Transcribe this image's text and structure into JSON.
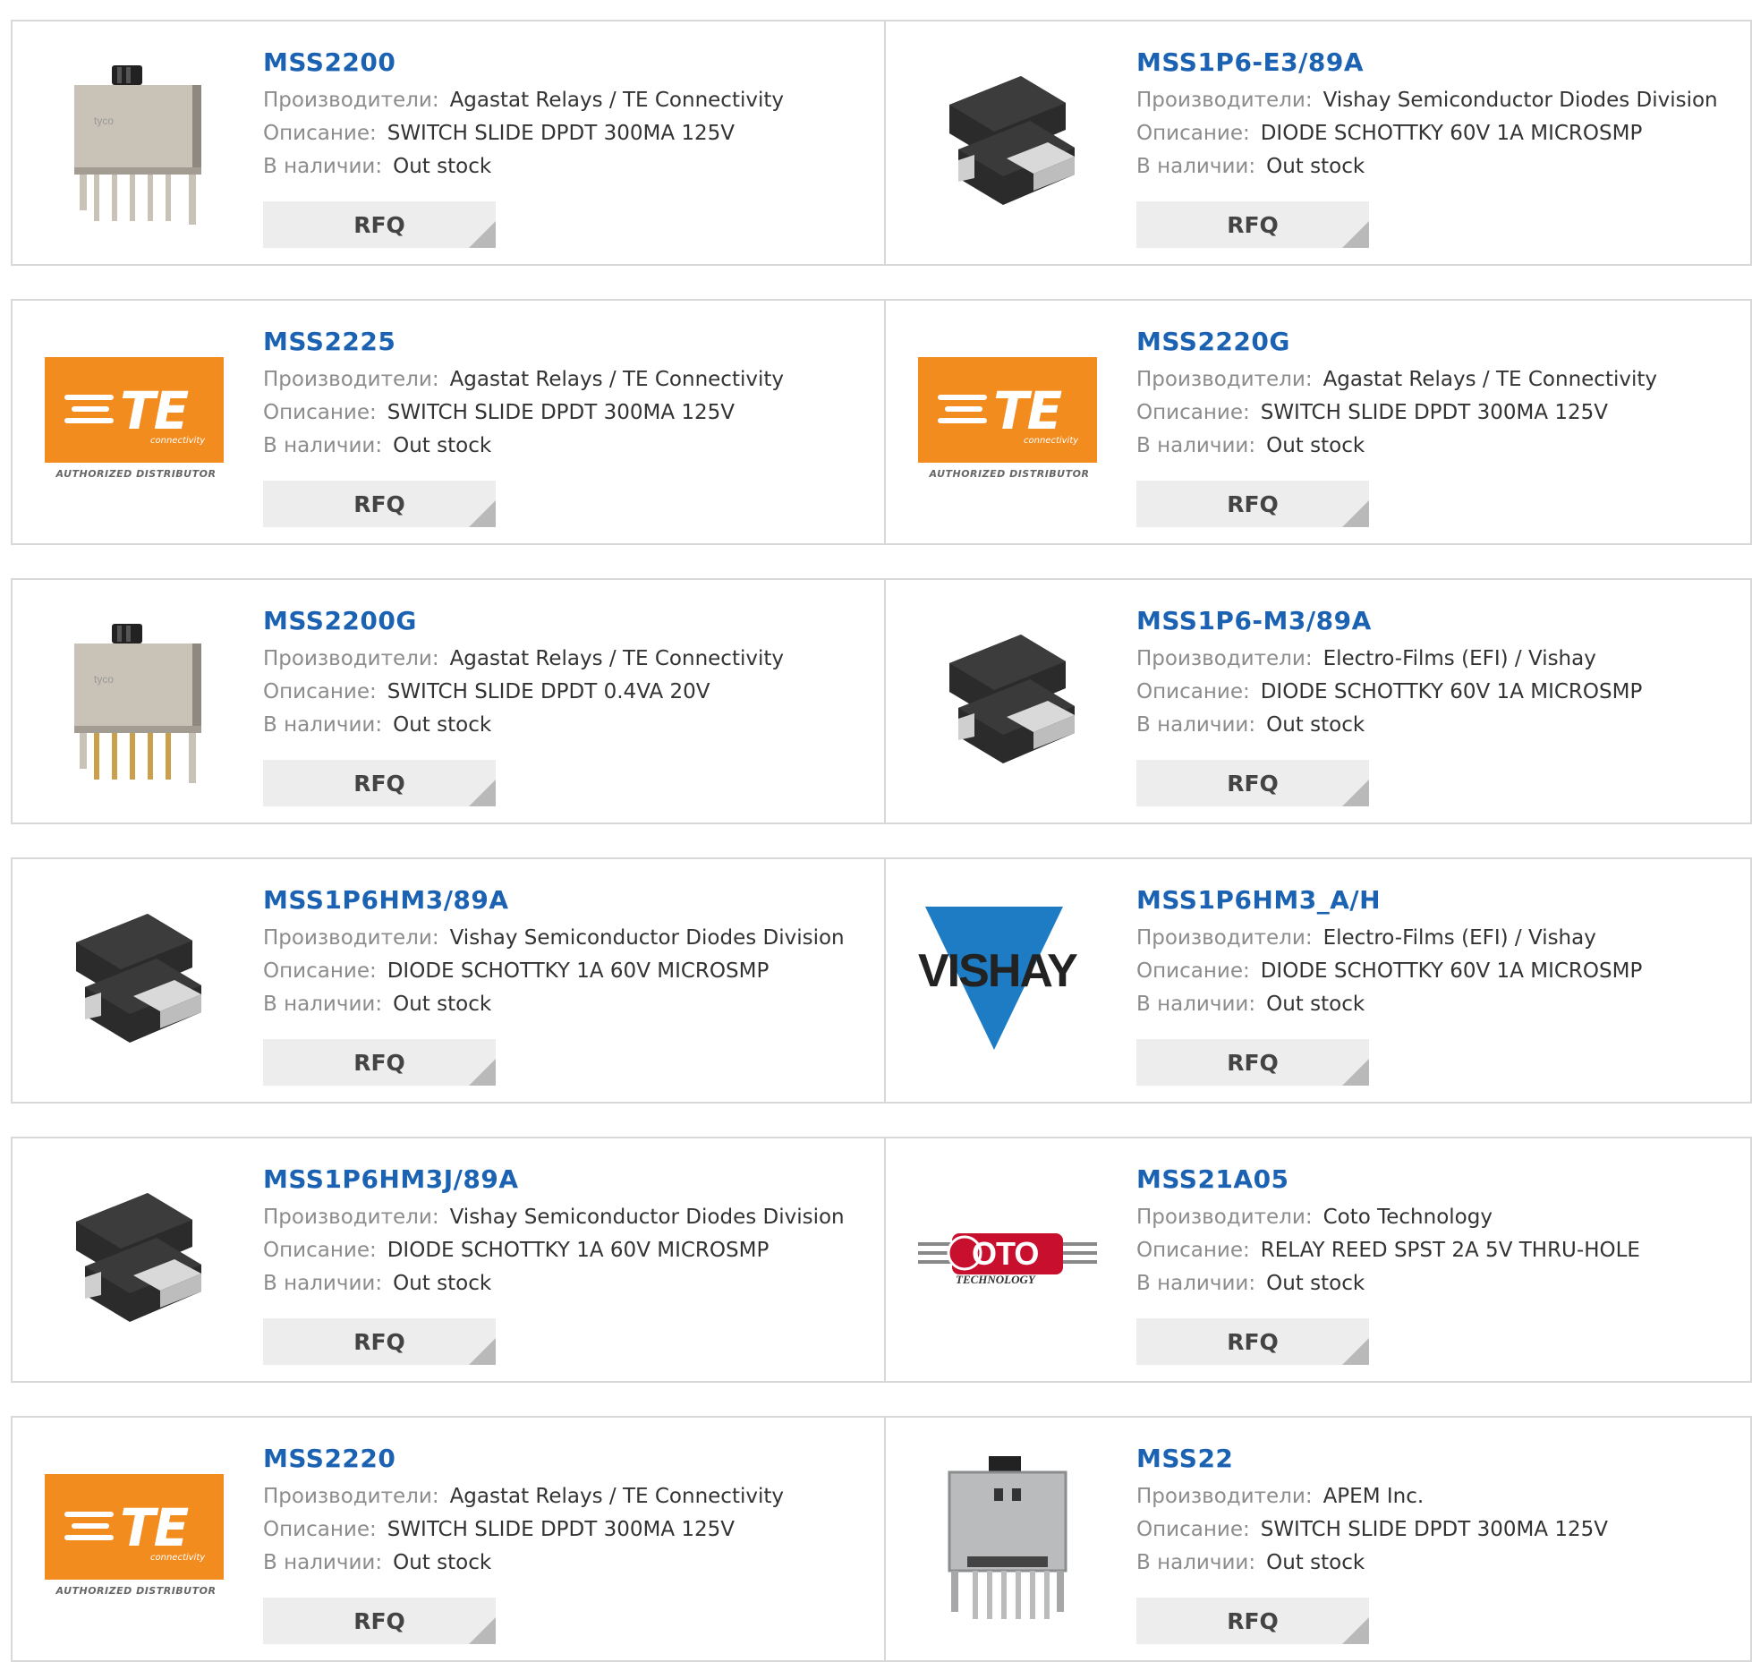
{
  "labels": {
    "manufacturer": "Производители:",
    "description": "Описание:",
    "stock": "В наличии:",
    "rfq": "RFQ"
  },
  "logos": {
    "te": {
      "word": "TE",
      "sub": "connectivity",
      "auth": "AUTHORIZED DISTRIBUTOR",
      "color": "#f28c1e"
    },
    "vishay": {
      "word": "VISHAY",
      "color": "#1d7cc4"
    },
    "coto": {
      "word": "OTO",
      "sub": "TECHNOLOGY",
      "color": "#c8102e"
    }
  },
  "colors": {
    "link": "#1b62b3",
    "label": "#8c8c8c",
    "button": "#ededed",
    "border": "#d8d8d8"
  },
  "products": [
    {
      "part": "MSS2200",
      "manufacturer": "Agastat Relays / TE Connectivity",
      "description": "SWITCH SLIDE DPDT 300MA 125V",
      "stock": "Out stock",
      "image": "slide-switch"
    },
    {
      "part": "MSS1P6-E3/89A",
      "manufacturer": "Vishay Semiconductor Diodes Division",
      "description": "DIODE SCHOTTKY 60V 1A MICROSMP",
      "stock": "Out stock",
      "image": "smd-diode"
    },
    {
      "part": "MSS2225",
      "manufacturer": "Agastat Relays / TE Connectivity",
      "description": "SWITCH SLIDE DPDT 300MA 125V",
      "stock": "Out stock",
      "image": "te-logo"
    },
    {
      "part": "MSS2220G",
      "manufacturer": "Agastat Relays / TE Connectivity",
      "description": "SWITCH SLIDE DPDT 300MA 125V",
      "stock": "Out stock",
      "image": "te-logo"
    },
    {
      "part": "MSS2200G",
      "manufacturer": "Agastat Relays / TE Connectivity",
      "description": "SWITCH SLIDE DPDT 0.4VA 20V",
      "stock": "Out stock",
      "image": "slide-switch-gold"
    },
    {
      "part": "MSS1P6-M3/89A",
      "manufacturer": "Electro-Films (EFI) / Vishay",
      "description": "DIODE SCHOTTKY 60V 1A MICROSMP",
      "stock": "Out stock",
      "image": "smd-diode"
    },
    {
      "part": "MSS1P6HM3/89A",
      "manufacturer": "Vishay Semiconductor Diodes Division",
      "description": "DIODE SCHOTTKY 1A 60V MICROSMP",
      "stock": "Out stock",
      "image": "smd-diode"
    },
    {
      "part": "MSS1P6HM3_A/H",
      "manufacturer": "Electro-Films (EFI) / Vishay",
      "description": "DIODE SCHOTTKY 60V 1A MICROSMP",
      "stock": "Out stock",
      "image": "vishay-logo"
    },
    {
      "part": "MSS1P6HM3J/89A",
      "manufacturer": "Vishay Semiconductor Diodes Division",
      "description": "DIODE SCHOTTKY 1A 60V MICROSMP",
      "stock": "Out stock",
      "image": "smd-diode"
    },
    {
      "part": "MSS21A05",
      "manufacturer": "Coto Technology",
      "description": "RELAY REED SPST 2A 5V THRU-HOLE",
      "stock": "Out stock",
      "image": "coto-logo"
    },
    {
      "part": "MSS2220",
      "manufacturer": "Agastat Relays / TE Connectivity",
      "description": "SWITCH SLIDE DPDT 300MA 125V",
      "stock": "Out stock",
      "image": "te-logo"
    },
    {
      "part": "MSS22",
      "manufacturer": "APEM Inc.",
      "description": "SWITCH SLIDE DPDT 300MA 125V",
      "stock": "Out stock",
      "image": "apem-switch"
    }
  ]
}
